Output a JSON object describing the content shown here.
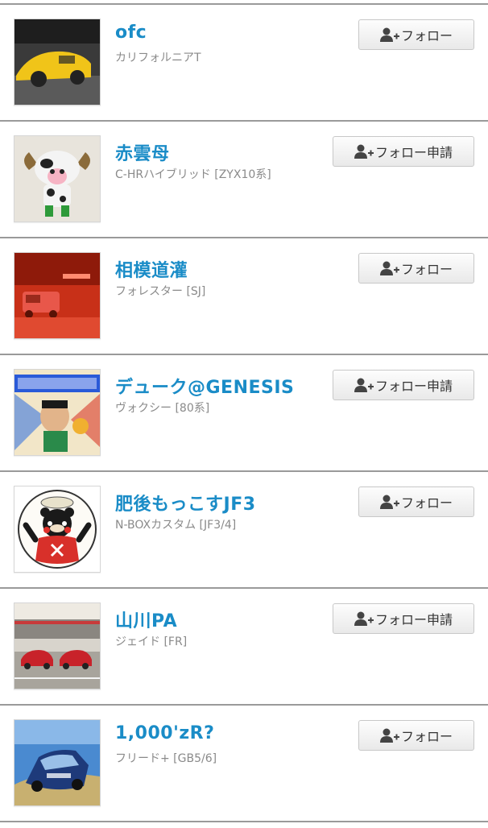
{
  "users": [
    {
      "name": "ofc",
      "car": "カリフォルニアT",
      "button": "フォロー",
      "type": "short",
      "thumb": "yellow-car"
    },
    {
      "name": "赤雲母",
      "car": "C-HRハイブリッド [ZYX10系]",
      "button": "フォロー申請",
      "type": "long",
      "thumb": "cow-figure"
    },
    {
      "name": "相模道灌",
      "car": "フォレスター [SJ]",
      "button": "フォロー",
      "type": "short",
      "thumb": "red-night"
    },
    {
      "name": "デューク@GENESIS",
      "car": "ヴォクシー [80系]",
      "button": "フォロー申請",
      "type": "long",
      "thumb": "manga"
    },
    {
      "name": "肥後もっこすJF3",
      "car": "N-BOXカスタム [JF3/4]",
      "button": "フォロー",
      "type": "short",
      "thumb": "kumamon"
    },
    {
      "name": "山川PA",
      "car": "ジェイド [FR]",
      "button": "フォロー申請",
      "type": "long",
      "thumb": "parking-cars"
    },
    {
      "name": "1,000'zR?",
      "car": "フリード+ [GB5/6]",
      "button": "フォロー",
      "type": "short",
      "thumb": "blue-car"
    }
  ],
  "colors": {
    "name": "#1a8cc7",
    "subtext": "#8a8a8a",
    "divider": "#9a9a9a"
  },
  "icons": {
    "follow": "add-user-icon"
  }
}
